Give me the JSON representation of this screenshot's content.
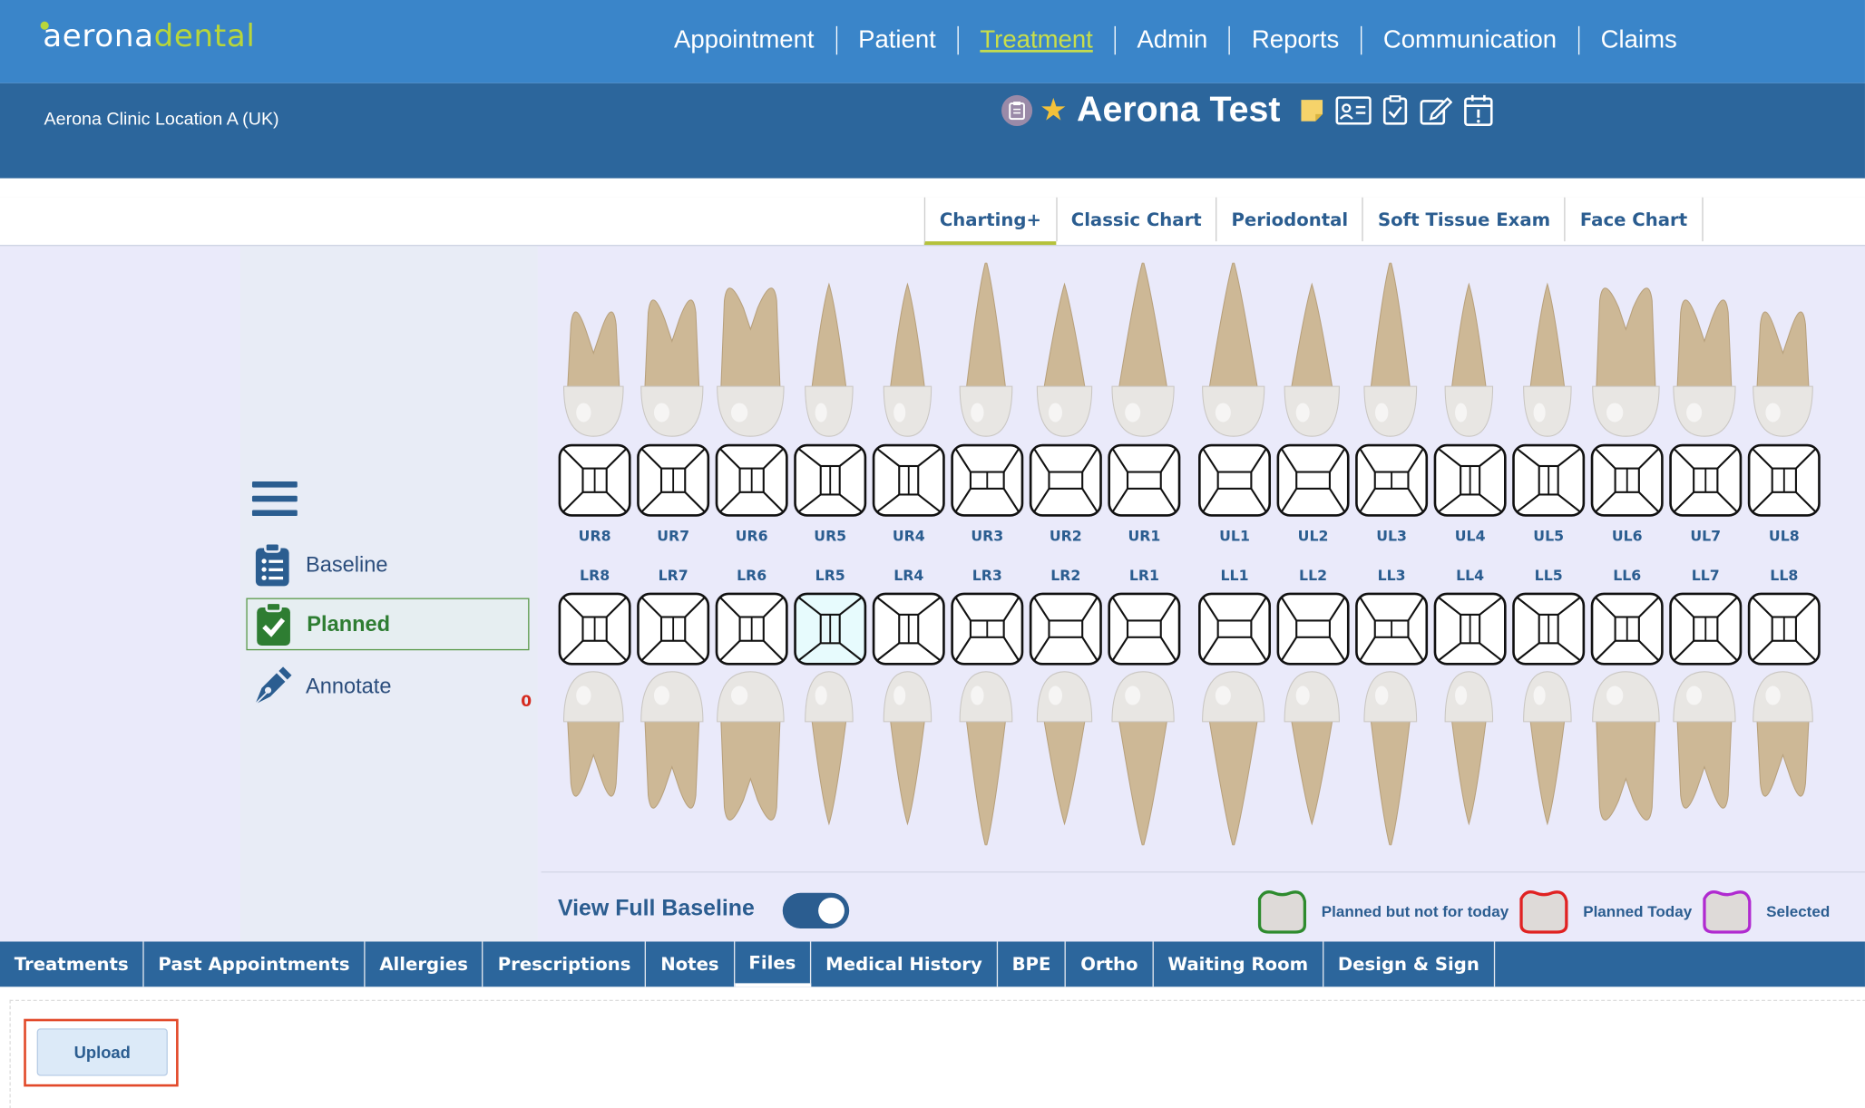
{
  "brand": {
    "part1": "aerona",
    "part2": "dental"
  },
  "nav": [
    {
      "label": "Appointment",
      "active": false
    },
    {
      "label": "Patient",
      "active": false
    },
    {
      "label": "Treatment",
      "active": true
    },
    {
      "label": "Admin",
      "active": false
    },
    {
      "label": "Reports",
      "active": false
    },
    {
      "label": "Communication",
      "active": false
    },
    {
      "label": "Claims",
      "active": false
    }
  ],
  "location": "Aerona Clinic Location A (UK)",
  "patient": {
    "name": "Aerona Test",
    "icons": [
      "clipboard-badge-icon",
      "star-icon",
      "sticky-note-icon",
      "id-card-icon",
      "clipboard-check-icon",
      "edit-icon",
      "calendar-alert-icon"
    ]
  },
  "chart_tabs": [
    {
      "label": "Charting+",
      "active": true
    },
    {
      "label": "Classic Chart",
      "active": false
    },
    {
      "label": "Periodontal",
      "active": false
    },
    {
      "label": "Soft Tissue Exam",
      "active": false
    },
    {
      "label": "Face Chart",
      "active": false
    }
  ],
  "modes": {
    "baseline": "Baseline",
    "planned": "Planned",
    "annotate": "Annotate",
    "annotate_count": "0"
  },
  "teeth": {
    "upper": [
      "UR8",
      "UR7",
      "UR6",
      "UR5",
      "UR4",
      "UR3",
      "UR2",
      "UR1",
      "UL1",
      "UL2",
      "UL3",
      "UL4",
      "UL5",
      "UL6",
      "UL7",
      "UL8"
    ],
    "lower": [
      "LR8",
      "LR7",
      "LR6",
      "LR5",
      "LR4",
      "LR3",
      "LR2",
      "LR1",
      "LL1",
      "LL2",
      "LL3",
      "LL4",
      "LL5",
      "LL6",
      "LL7",
      "LL8"
    ],
    "highlighted": "LR5"
  },
  "view_full_baseline": {
    "label": "View Full Baseline",
    "on": true
  },
  "legend": [
    {
      "label": "Planned but not for today",
      "color": "#2e8b2e"
    },
    {
      "label": "Planned Today",
      "color": "#e02222"
    },
    {
      "label": "Selected",
      "color": "#b02ad0"
    }
  ],
  "bottom_tabs": [
    {
      "label": "Treatments",
      "active": false
    },
    {
      "label": "Past Appointments",
      "active": false
    },
    {
      "label": "Allergies",
      "active": false
    },
    {
      "label": "Prescriptions",
      "active": false
    },
    {
      "label": "Notes",
      "active": false
    },
    {
      "label": "Files",
      "active": true
    },
    {
      "label": "Medical History",
      "active": false
    },
    {
      "label": "BPE",
      "active": false
    },
    {
      "label": "Ortho",
      "active": false
    },
    {
      "label": "Waiting Room",
      "active": false
    },
    {
      "label": "Design & Sign",
      "active": false
    }
  ],
  "files": {
    "upload_label": "Upload"
  },
  "colors": {
    "topbar": "#3a85c9",
    "subbar": "#2c669c",
    "accent": "#c9de4a",
    "planned": "#2e7d32"
  }
}
